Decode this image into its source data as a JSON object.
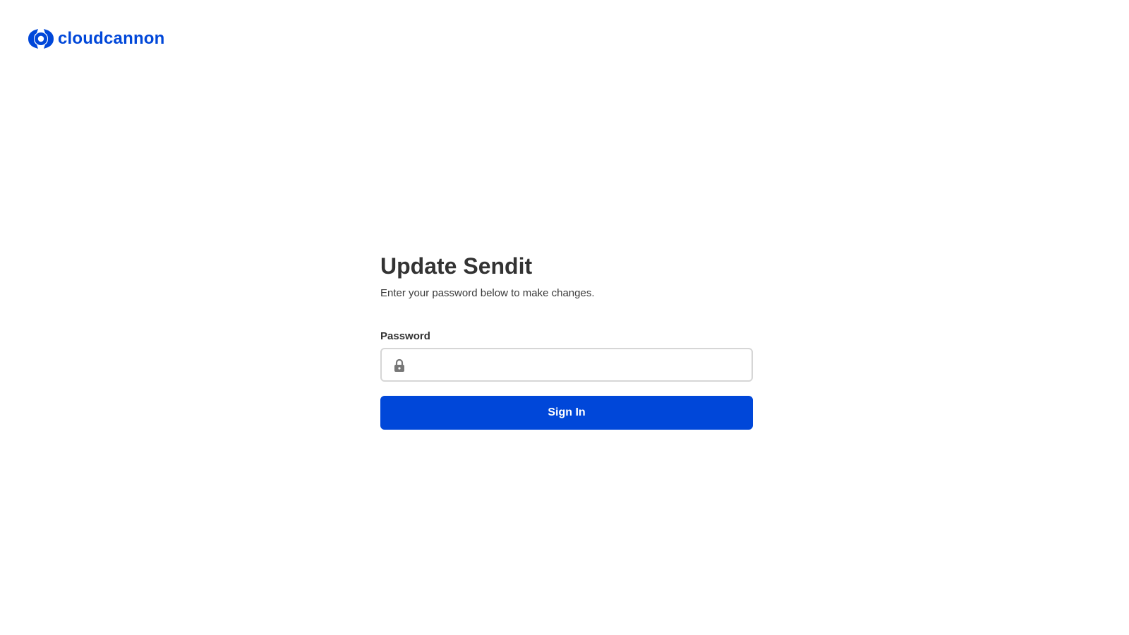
{
  "header": {
    "logo_text": "cloudcannon",
    "logo_icon": "cloudcannon-logo-icon"
  },
  "colors": {
    "brand": "#0047d9",
    "text": "#333333",
    "input_border": "#d6d6d6",
    "icon": "#777777"
  },
  "login": {
    "title": "Update Sendit",
    "subtitle": "Enter your password below to make changes.",
    "password_label": "Password",
    "password_value": "",
    "password_icon": "lock-icon",
    "submit_label": "Sign In"
  }
}
